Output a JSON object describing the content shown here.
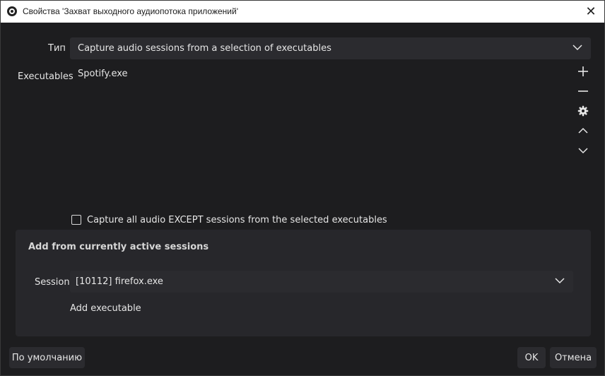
{
  "window": {
    "title": "Свойства 'Захват выходного аудиопотока приложений'",
    "close_glyph": "✕"
  },
  "type_field": {
    "label": "Тип",
    "value": "Capture audio sessions from a selection of executables"
  },
  "executables": {
    "label": "Executables",
    "items": [
      "Spotify.exe"
    ]
  },
  "side_buttons": [
    "add-icon",
    "remove-icon",
    "gear-icon",
    "chevron-up-icon",
    "chevron-down-icon"
  ],
  "exclude_checkbox": {
    "label": "Capture all audio EXCEPT sessions from the selected executables",
    "checked": false
  },
  "active_sessions": {
    "title": "Add from currently active sessions",
    "session_label": "Session",
    "session_value": "[10112] firefox.exe",
    "add_button": "Add executable"
  },
  "footer": {
    "defaults_button": "По умолчанию",
    "ok_button": "OK",
    "cancel_button": "Отмена"
  },
  "colors": {
    "background": "#1d1d1f",
    "field": "#2b2b2f",
    "group": "#27272b",
    "titlebar": "#ffffff"
  }
}
